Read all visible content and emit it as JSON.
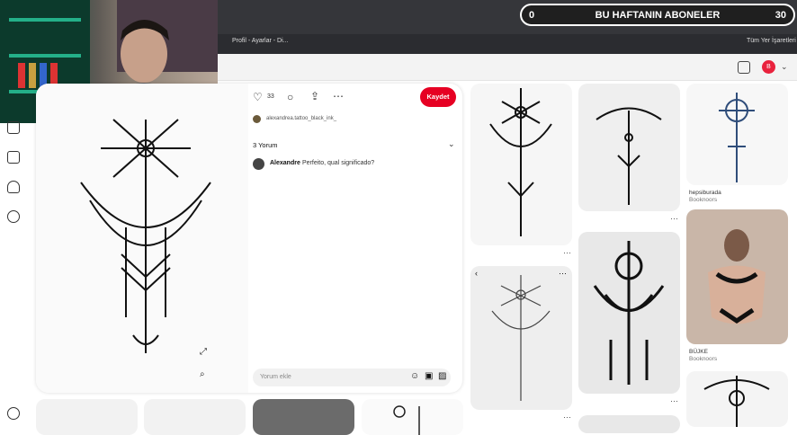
{
  "overlay": {
    "left_number": "0",
    "title": "BU HAFTANIN ABONELER",
    "right_number": "30"
  },
  "bookmarks": {
    "item1": "Profil - Ayarlar - Di...",
    "all_bookmarks": "Tüm Yer İşaretleri"
  },
  "user_initial": "B",
  "pin": {
    "like_count": "33",
    "save_label": "Kaydet",
    "author": "alexandrea.tattoo_black_ink_",
    "comments_header": "3 Yorum",
    "comment": {
      "user": "Alexandre",
      "text": "Perfeito, qual significado?"
    },
    "comment_placeholder": "Yorum ekle"
  },
  "feed": {
    "tile1_title": "hepsiburada",
    "tile1_sub": "Booknoors",
    "tile2_title": "BÜJKE",
    "tile2_sub": "Booknoors"
  },
  "colors": {
    "accent": "#e60023",
    "chrome": "#35363a"
  },
  "icons": [
    "heart-icon",
    "comment-icon",
    "share-icon",
    "more-icon",
    "expand-icon",
    "search-lens-icon",
    "emoji-icon",
    "sticker-icon",
    "image-icon",
    "home-icon",
    "create-icon",
    "bell-icon",
    "messages-icon",
    "settings-icon",
    "camera-search-icon",
    "chevron-down-icon"
  ]
}
